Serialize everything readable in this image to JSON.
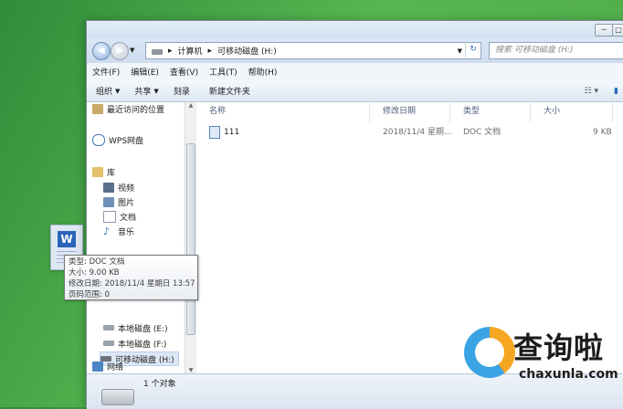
{
  "address": {
    "segments": [
      "计算机",
      "可移动磁盘 (H:)"
    ],
    "search_placeholder": "搜索 可移动磁盘 (H:)"
  },
  "menu": [
    "文件(F)",
    "编辑(E)",
    "查看(V)",
    "工具(T)",
    "帮助(H)"
  ],
  "toolbar": {
    "organize": "组织",
    "share": "共享",
    "burn": "刻录",
    "new_folder": "新建文件夹"
  },
  "sidebar": {
    "recent": "最近访问的位置",
    "wps": "WPS网盘",
    "library": "库",
    "videos": "视频",
    "pictures": "图片",
    "documents": "文档",
    "music": "音乐",
    "drive_e": "本地磁盘 (E:)",
    "drive_f": "本地磁盘 (F:)",
    "drive_h": "可移动磁盘 (H:)",
    "network": "网络"
  },
  "columns": {
    "name": "名称",
    "modified": "修改日期",
    "type": "类型",
    "size": "大小"
  },
  "files": [
    {
      "name": "111",
      "modified": "2018/11/4 星期...",
      "type": "DOC 文档",
      "size": "9 KB"
    }
  ],
  "status": {
    "count": "1 个对象"
  },
  "tooltip": {
    "type": "类型: DOC 文档",
    "size": "大小: 9.00 KB",
    "modified": "修改日期: 2018/11/4 星期日 13:57",
    "pages": "页码范围: 0"
  },
  "watermark": {
    "brand": "查询啦",
    "domain": "chaxunla.com"
  },
  "window_buttons": [
    "─",
    "□"
  ],
  "colors": {
    "accent": "#2e6bb8",
    "desktop": "#4ea84a"
  }
}
